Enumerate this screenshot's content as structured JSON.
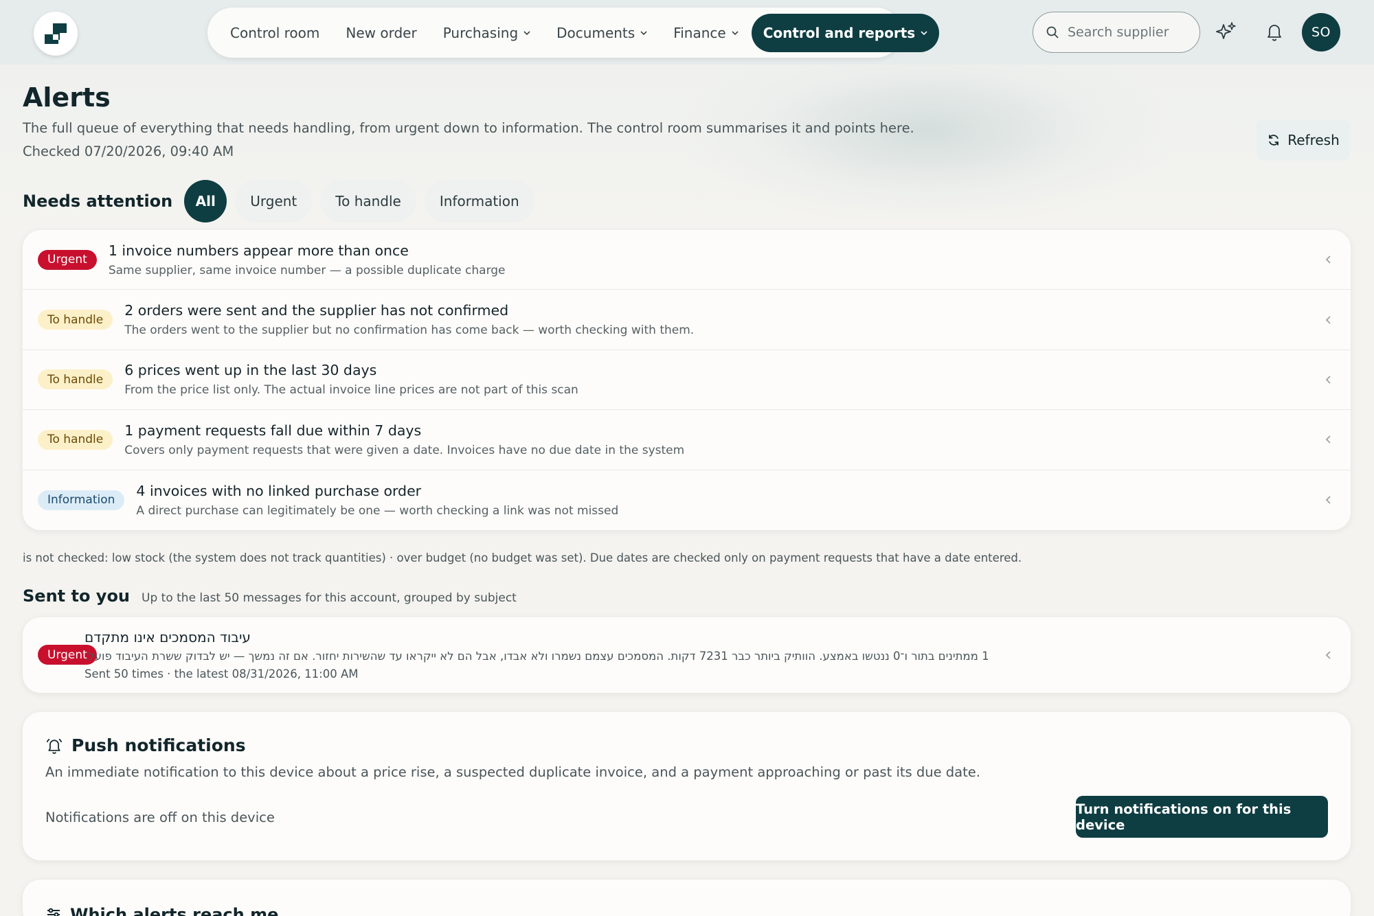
{
  "nav": {
    "items": [
      {
        "label": "Control room",
        "dropdown": false
      },
      {
        "label": "New order",
        "dropdown": false
      },
      {
        "label": "Purchasing",
        "dropdown": true
      },
      {
        "label": "Documents",
        "dropdown": true
      },
      {
        "label": "Finance",
        "dropdown": true
      },
      {
        "label": "Control and reports",
        "dropdown": true,
        "active": true
      }
    ]
  },
  "search": {
    "placeholder": "Search supplier"
  },
  "user": {
    "initials": "SO"
  },
  "page": {
    "title": "Alerts",
    "description": "The full queue of everything that needs handling, from urgent down to information. The control room summarises it and points here.",
    "checked": "Checked 07/20/2026, 09:40 AM",
    "refresh_label": "Refresh"
  },
  "filters": {
    "label": "Needs attention",
    "chips": [
      "All",
      "Urgent",
      "To handle",
      "Information"
    ],
    "active": "All"
  },
  "alerts": [
    {
      "badge": "Urgent",
      "severity": "urgent",
      "title": "1 invoice numbers appear more than once",
      "subtitle": "Same supplier, same invoice number — a possible duplicate charge"
    },
    {
      "badge": "To handle",
      "severity": "handle",
      "title": "2 orders were sent and the supplier has not confirmed",
      "subtitle": "The orders went to the supplier but no confirmation has come back — worth checking with them."
    },
    {
      "badge": "To handle",
      "severity": "handle",
      "title": "6 prices went up in the last 30 days",
      "subtitle": "From the price list only. The actual invoice line prices are not part of this scan"
    },
    {
      "badge": "To handle",
      "severity": "handle",
      "title": "1 payment requests fall due within 7 days",
      "subtitle": "Covers only payment requests that were given a date. Invoices have no due date in the system"
    },
    {
      "badge": "Information",
      "severity": "info",
      "title": "4 invoices with no linked purchase order",
      "subtitle": "A direct purchase can legitimately be one — worth checking a link was not missed"
    }
  ],
  "footnote": "is not checked: low stock (the system does not track quantities) · over budget (no budget was set). Due dates are checked only on payment requests that have a date entered.",
  "sent": {
    "title": "Sent to you",
    "subtitle": "Up to the last 50 messages for this account, grouped by subject",
    "messages": [
      {
        "badge": "Urgent",
        "title": "עיבוד המסמכים אינו מתקדם",
        "body": "1 ממתינים בתור ו־0 ננטשו באמצע. הוותיק ביותר כבר 7231 דקות. המסמכים עצמם נשמרו ולא אבדו, אבל הם לא ייקראו עד שהשירות יחזור. אם זה נמשך — יש לבדוק ששרת העיבוד פועל.",
        "meta": "Sent 50 times · the latest 08/31/2026, 11:00 AM"
      }
    ]
  },
  "push": {
    "title": "Push notifications",
    "description": "An immediate notification to this device about a price rise, a suspected duplicate invoice, and a payment approaching or past its due date.",
    "status": "Notifications are off on this device",
    "button_label": "Turn notifications on for this device"
  },
  "which": {
    "title": "Which alerts reach me"
  },
  "colors": {
    "primary": "#0e3d42",
    "urgent": "#c8102e",
    "handle_bg": "#fcf0c8",
    "info_bg": "#dcecf7"
  }
}
